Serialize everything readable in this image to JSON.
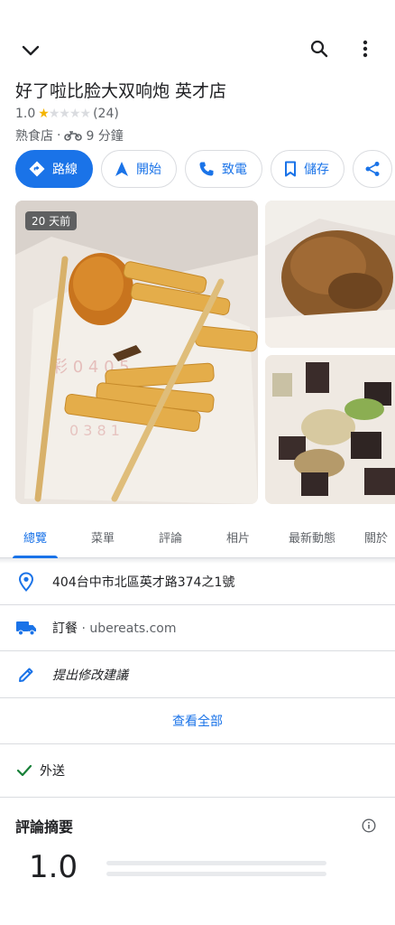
{
  "place": {
    "name": "好了啦比脸大双响炮 英才店",
    "rating": "1.0",
    "stars_filled": 1,
    "stars_total": 5,
    "review_count": "(24)",
    "category": "熟食店",
    "separator": "·",
    "travel_time": "9 分鐘"
  },
  "actions": [
    {
      "label": "路線",
      "icon": "directions-icon"
    },
    {
      "label": "開始",
      "icon": "navigation-arrow-icon"
    },
    {
      "label": "致電",
      "icon": "phone-icon"
    },
    {
      "label": "儲存",
      "icon": "bookmark-icon"
    }
  ],
  "photos": {
    "badge": "20 天前"
  },
  "tabs": [
    "總覽",
    "菜單",
    "評論",
    "相片",
    "最新動態",
    "關於"
  ],
  "active_tab": "總覽",
  "info": {
    "address": "404台中市北區英才路374之1號",
    "order_label": "訂餐",
    "order_dot": "·",
    "order_site": "ubereats.com",
    "suggest_edit": "提出修改建議",
    "see_all": "查看全部"
  },
  "features": {
    "delivery": "外送"
  },
  "review_summary": {
    "title": "評論摘要",
    "average": "1.0"
  },
  "colors": {
    "accent": "#1a73e8",
    "star": "#f4b400",
    "check": "#188038"
  }
}
